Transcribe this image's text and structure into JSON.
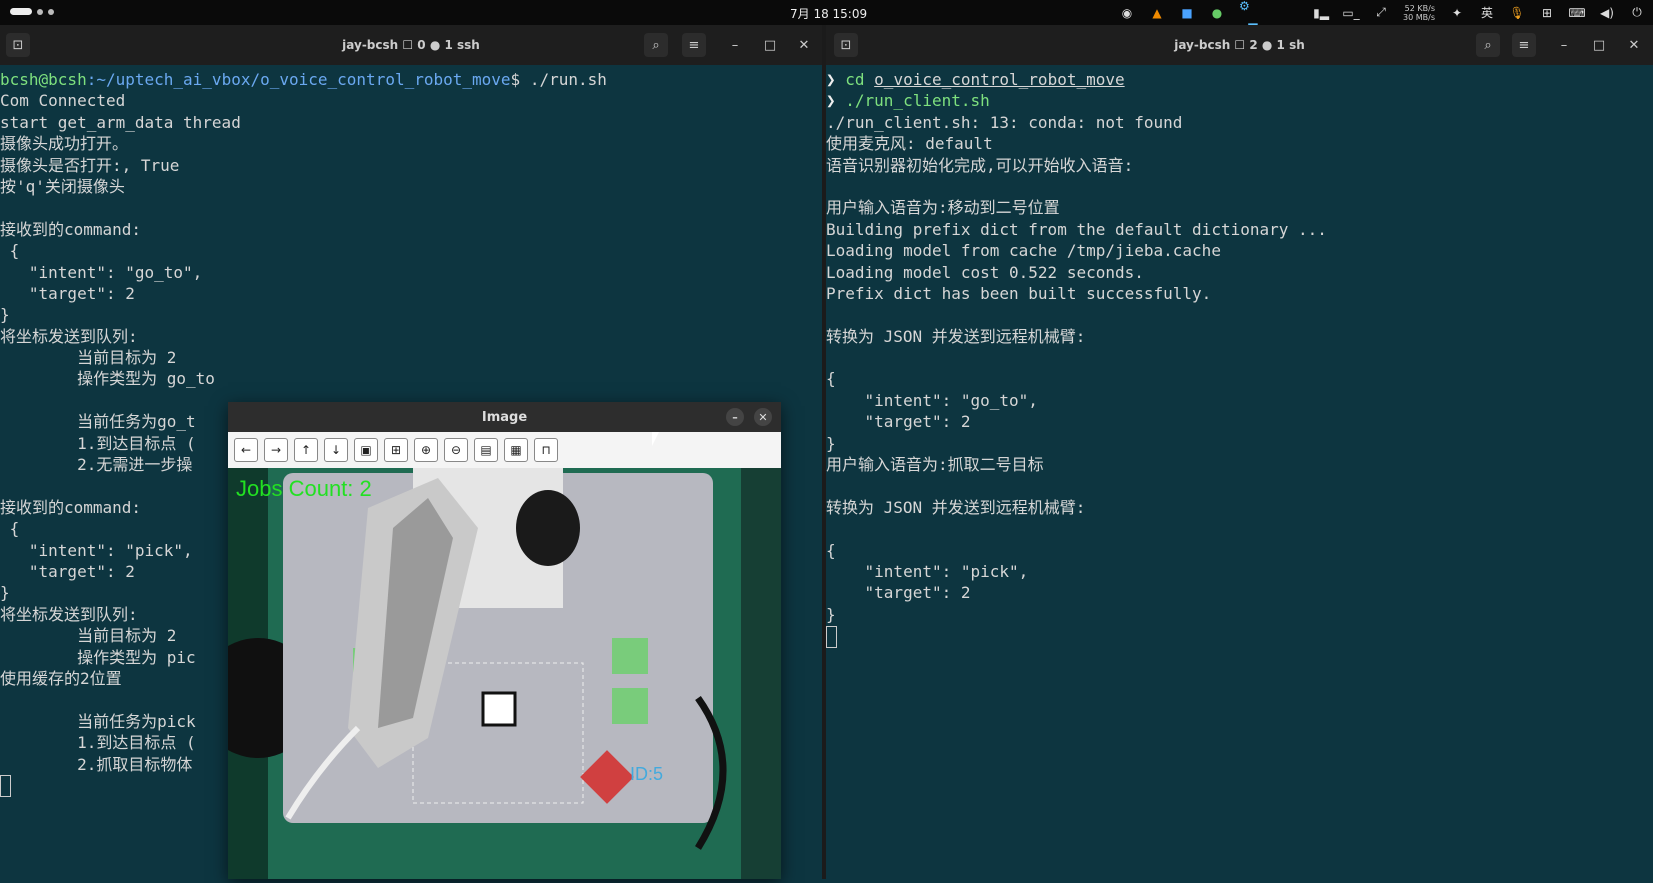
{
  "topbar": {
    "clock": "7月 18 15:09",
    "net_up": "52 KB/s",
    "net_down": "30 MB/s",
    "input_method": "英"
  },
  "left_terminal": {
    "title": "jay-bcsh ☐ 0 ● 1 ssh",
    "prompt_user": "bcsh@bcsh",
    "prompt_path": ":~/uptech_ai_vbox/o_voice_control_robot_move",
    "prompt_cmd": "$ ./run.sh",
    "lines": [
      "Com Connected",
      "start get_arm_data thread",
      "摄像头成功打开。",
      "摄像头是否打开:, True",
      "按'q'关闭摄像头",
      "",
      "接收到的command:",
      " {",
      "   \"intent\": \"go_to\",",
      "   \"target\": 2",
      "}",
      "将坐标发送到队列:",
      "        当前目标为 2",
      "        操作类型为 go_to",
      "",
      "        当前任务为go_t",
      "        1.到达目标点 (",
      "        2.无需进一步操",
      "",
      "接收到的command:",
      " {",
      "   \"intent\": \"pick\",",
      "   \"target\": 2",
      "}",
      "将坐标发送到队列:",
      "        当前目标为 2",
      "        操作类型为 pic",
      "使用缓存的2位置",
      "",
      "        当前任务为pick",
      "        1.到达目标点 (",
      "        2.抓取目标物体"
    ]
  },
  "right_terminal": {
    "title": "jay-bcsh ☐ 2 ● 1 sh",
    "cmd1_prefix": "cd ",
    "cmd1_arg": "o_voice_control_robot_move",
    "cmd2": "./run_client.sh",
    "lines": [
      "./run_client.sh: 13: conda: not found",
      "使用麦克风: default",
      "语音识别器初始化完成,可以开始收入语音:",
      "",
      "用户输入语音为:移动到二号位置",
      "Building prefix dict from the default dictionary ...",
      "Loading model from cache /tmp/jieba.cache",
      "Loading model cost 0.522 seconds.",
      "Prefix dict has been built successfully.",
      "",
      "转换为 JSON 并发送到远程机械臂:",
      "",
      "{",
      "    \"intent\": \"go_to\",",
      "    \"target\": 2",
      "}",
      "用户输入语音为:抓取二号目标",
      "",
      "转换为 JSON 并发送到远程机械臂:",
      "",
      "{",
      "    \"intent\": \"pick\",",
      "    \"target\": 2",
      "}"
    ]
  },
  "image_window": {
    "title": "Image",
    "overlay_text": "Jobs Count: 2",
    "id_label": "ID:5"
  }
}
